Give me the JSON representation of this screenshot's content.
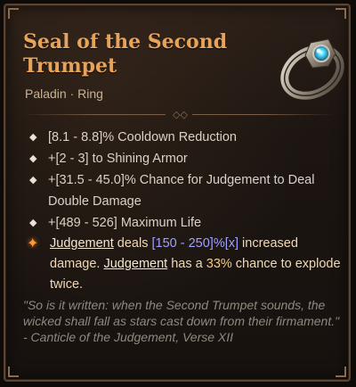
{
  "item": {
    "name": "Seal of the Second Trumpet",
    "class_type": "Paladin · Ring"
  },
  "stats": [
    "[8.1 - 8.8]% Cooldown Reduction",
    "+[2 - 3] to Shining Armor",
    "+[31.5 - 45.0]% Chance for Judgement to Deal Double Damage",
    "+[489 - 526] Maximum Life"
  ],
  "unique_effect": {
    "keyword": "Judgement",
    "text1": " deals ",
    "range": "[150 - 250]%[x]",
    "text2": " increased damage. ",
    "keyword2": "Judgement",
    "text3": " has a ",
    "chance": "33%",
    "text4": " chance to explode twice."
  },
  "flavor_text": "\"So is it written: when the Second Trumpet sounds, the wicked shall fall as stars cast down from their firmament.\" - Canticle of the Judgement, Verse XII",
  "colors": {
    "title": "#e8a35a",
    "stat_text": "#d8d2c8",
    "range_highlight": "#9fa0ff",
    "unique_star": "#ff9a3c"
  },
  "icons": [
    "ring-item-icon",
    "diamond-bullet-icon",
    "unique-star-icon"
  ]
}
